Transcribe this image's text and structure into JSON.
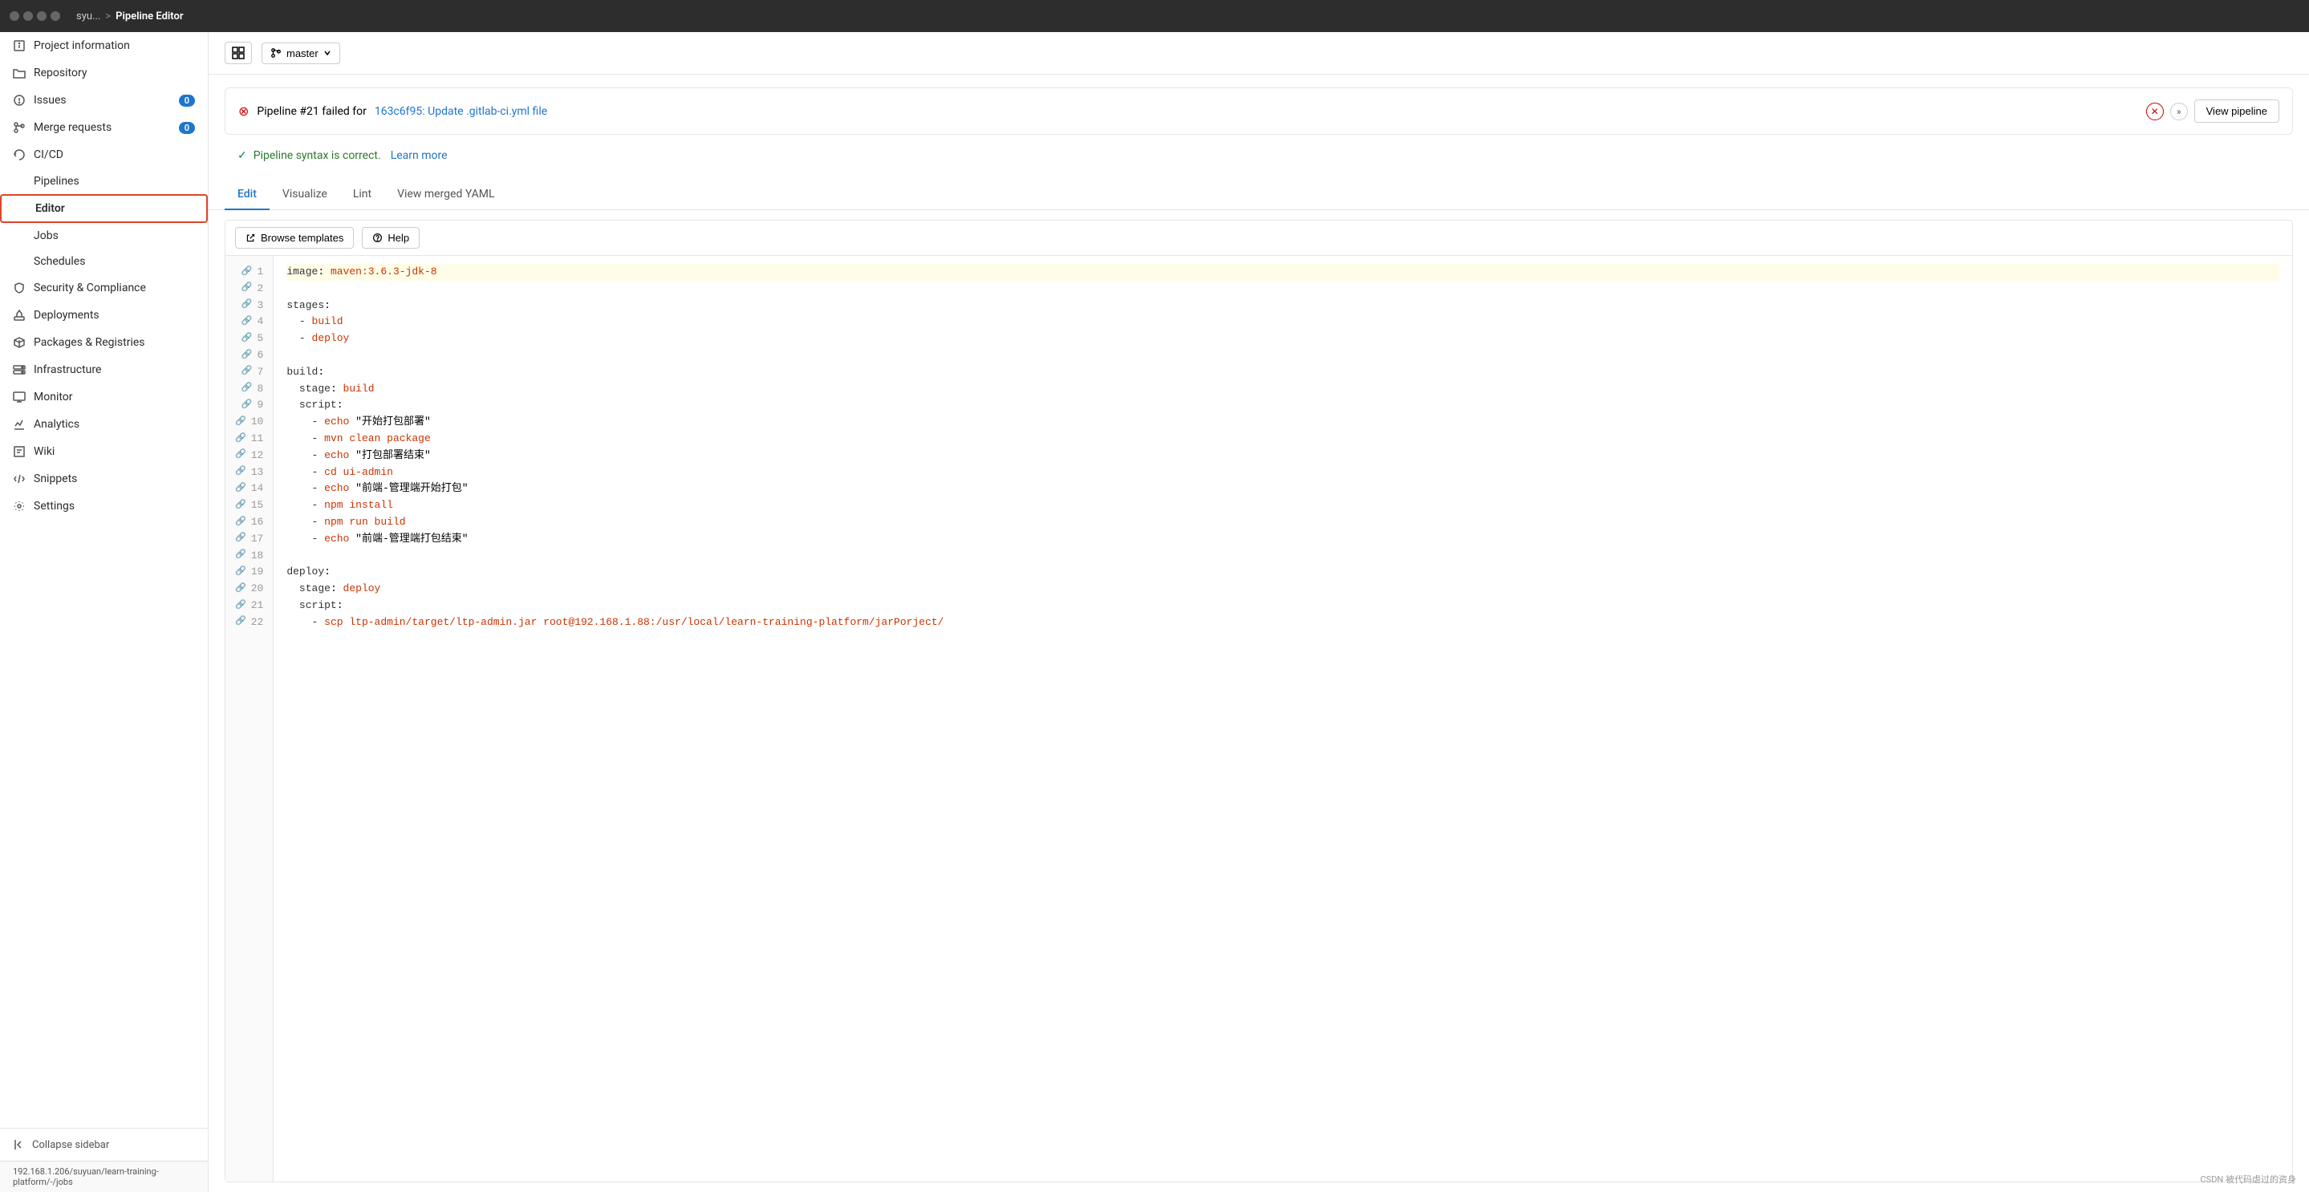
{
  "topbar": {
    "breadcrumb_prefix": "syu...",
    "breadcrumb_sep": ">",
    "breadcrumb_active": "Pipeline Editor"
  },
  "sidebar": {
    "items": [
      {
        "id": "project-info",
        "label": "Project information",
        "icon": "info",
        "badge": null,
        "sub": []
      },
      {
        "id": "repository",
        "label": "Repository",
        "icon": "folder",
        "badge": null,
        "sub": []
      },
      {
        "id": "issues",
        "label": "Issues",
        "icon": "issues",
        "badge": "0",
        "sub": []
      },
      {
        "id": "merge-requests",
        "label": "Merge requests",
        "icon": "merge",
        "badge": "0",
        "sub": []
      },
      {
        "id": "cicd",
        "label": "CI/CD",
        "icon": "cicd",
        "badge": null,
        "sub": [
          {
            "id": "pipelines",
            "label": "Pipelines"
          },
          {
            "id": "editor",
            "label": "Editor",
            "active": true
          },
          {
            "id": "jobs",
            "label": "Jobs"
          },
          {
            "id": "schedules",
            "label": "Schedules"
          }
        ]
      },
      {
        "id": "security",
        "label": "Security & Compliance",
        "icon": "shield",
        "badge": null,
        "sub": []
      },
      {
        "id": "deployments",
        "label": "Deployments",
        "icon": "deploy",
        "badge": null,
        "sub": []
      },
      {
        "id": "packages",
        "label": "Packages & Registries",
        "icon": "package",
        "badge": null,
        "sub": []
      },
      {
        "id": "infrastructure",
        "label": "Infrastructure",
        "icon": "infra",
        "badge": null,
        "sub": []
      },
      {
        "id": "monitor",
        "label": "Monitor",
        "icon": "monitor",
        "badge": null,
        "sub": []
      },
      {
        "id": "analytics",
        "label": "Analytics",
        "icon": "analytics",
        "badge": null,
        "sub": []
      },
      {
        "id": "wiki",
        "label": "Wiki",
        "icon": "wiki",
        "badge": null,
        "sub": []
      },
      {
        "id": "snippets",
        "label": "Snippets",
        "icon": "snippets",
        "badge": null,
        "sub": []
      },
      {
        "id": "settings",
        "label": "Settings",
        "icon": "settings",
        "badge": null,
        "sub": []
      }
    ],
    "collapse_label": "Collapse sidebar",
    "url": "192.168.1.206/suyuan/learn-training-platform/-/jobs"
  },
  "header": {
    "branch_name": "master",
    "branch_icon": "git-branch"
  },
  "alert": {
    "error_text": "Pipeline #21 failed for",
    "link_text": "163c6f95: Update .gitlab-ci.yml file",
    "link_href": "#",
    "view_pipeline_label": "View pipeline"
  },
  "success": {
    "text": "Pipeline syntax is correct.",
    "link_text": "Learn more",
    "link_href": "#"
  },
  "tabs": [
    {
      "id": "edit",
      "label": "Edit",
      "active": true
    },
    {
      "id": "visualize",
      "label": "Visualize",
      "active": false
    },
    {
      "id": "lint",
      "label": "Lint",
      "active": false
    },
    {
      "id": "view-merged",
      "label": "View merged YAML",
      "active": false
    }
  ],
  "editor": {
    "browse_templates_label": "Browse templates",
    "help_label": "Help",
    "lines": [
      {
        "num": 1,
        "content": "image: maven:3.6.3-jdk-8",
        "highlighted": true
      },
      {
        "num": 2,
        "content": "",
        "highlighted": false
      },
      {
        "num": 3,
        "content": "stages:",
        "highlighted": false
      },
      {
        "num": 4,
        "content": "  - build",
        "highlighted": false
      },
      {
        "num": 5,
        "content": "  - deploy",
        "highlighted": false
      },
      {
        "num": 6,
        "content": "",
        "highlighted": false
      },
      {
        "num": 7,
        "content": "build:",
        "highlighted": false
      },
      {
        "num": 8,
        "content": "  stage: build",
        "highlighted": false
      },
      {
        "num": 9,
        "content": "  script:",
        "highlighted": false
      },
      {
        "num": 10,
        "content": "    - echo \"开始打包部署\"",
        "highlighted": false
      },
      {
        "num": 11,
        "content": "    - mvn clean package",
        "highlighted": false
      },
      {
        "num": 12,
        "content": "    - echo \"打包部署结束\"",
        "highlighted": false
      },
      {
        "num": 13,
        "content": "    - cd ui-admin",
        "highlighted": false
      },
      {
        "num": 14,
        "content": "    - echo \"前端-管理端开始打包\"",
        "highlighted": false
      },
      {
        "num": 15,
        "content": "    - npm install",
        "highlighted": false
      },
      {
        "num": 16,
        "content": "    - npm run build",
        "highlighted": false
      },
      {
        "num": 17,
        "content": "    - echo \"前端-管理端打包结束\"",
        "highlighted": false
      },
      {
        "num": 18,
        "content": "",
        "highlighted": false
      },
      {
        "num": 19,
        "content": "deploy:",
        "highlighted": false
      },
      {
        "num": 20,
        "content": "  stage: deploy",
        "highlighted": false
      },
      {
        "num": 21,
        "content": "  script:",
        "highlighted": false
      },
      {
        "num": 22,
        "content": "    - scp ltp-admin/target/ltp-admin.jar root@192.168.1.88:/usr/local/learn-training-platform/jarPorject/",
        "highlighted": false
      }
    ]
  },
  "watermark": "CSDN 被代码虐过的资身"
}
